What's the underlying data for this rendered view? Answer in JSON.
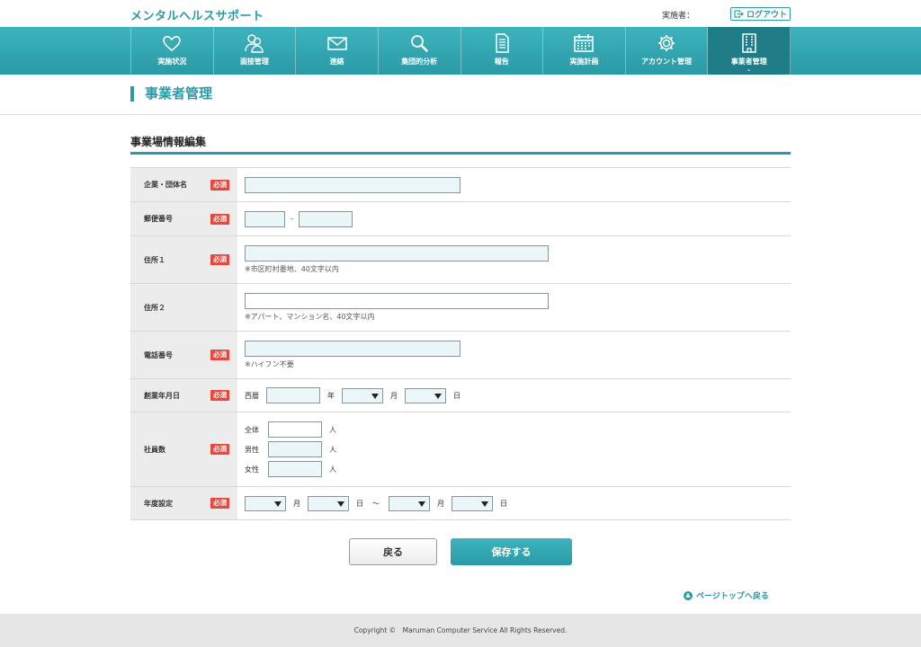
{
  "header": {
    "app_title": "メンタルヘルスサポート",
    "user_label": "実施者：",
    "logout_label": "ログアウト"
  },
  "nav": {
    "items": [
      {
        "label": "実施状況",
        "icon": "heart-icon"
      },
      {
        "label": "面接管理",
        "icon": "people-icon"
      },
      {
        "label": "連絡",
        "icon": "mail-icon"
      },
      {
        "label": "集団的分析",
        "icon": "search-icon"
      },
      {
        "label": "報告",
        "icon": "document-icon"
      },
      {
        "label": "実施計画",
        "icon": "calendar-icon"
      },
      {
        "label": "アカウント管理",
        "icon": "gear-icon"
      },
      {
        "label": "事業者管理",
        "icon": "building-icon",
        "active": true
      }
    ]
  },
  "page": {
    "title": "事業者管理",
    "section_title": "事業場情報編集"
  },
  "form": {
    "required_label": "必須",
    "company": {
      "label": "企業・団体名",
      "value": ""
    },
    "postal": {
      "label": "郵便番号",
      "separator": "-",
      "value1": "",
      "value2": ""
    },
    "address1": {
      "label": "住所１",
      "value": "",
      "note": "※市区町村番地、40文字以内"
    },
    "address2": {
      "label": "住所２",
      "value": "",
      "note": "※アパート、マンション名、40文字以内"
    },
    "phone": {
      "label": "電話番号",
      "value": "",
      "note": "※ハイフン不要"
    },
    "founded": {
      "label": "創業年月日",
      "era": "西暦",
      "year_unit": "年",
      "month_unit": "月",
      "day_unit": "日",
      "year": "",
      "month": "",
      "day": ""
    },
    "employees": {
      "label": "社員数",
      "unit": "人",
      "rows": [
        {
          "label": "全体",
          "value": ""
        },
        {
          "label": "男性",
          "value": ""
        },
        {
          "label": "女性",
          "value": ""
        }
      ]
    },
    "fiscal": {
      "label": "年度設定",
      "month_unit": "月",
      "day_unit": "日",
      "tilde": "〜",
      "from_month": "",
      "from_day": "",
      "to_month": "",
      "to_day": ""
    }
  },
  "actions": {
    "back_label": "戻る",
    "save_label": "保存する"
  },
  "pagetop_label": "ページトップへ戻る",
  "footer": {
    "copyright": "Copyright ©　Maruman Computer Service All Rights Reserved."
  },
  "colors": {
    "accent": "#2a9aa6",
    "required": "#e9463d",
    "input_bg": "#eaf6f8"
  }
}
